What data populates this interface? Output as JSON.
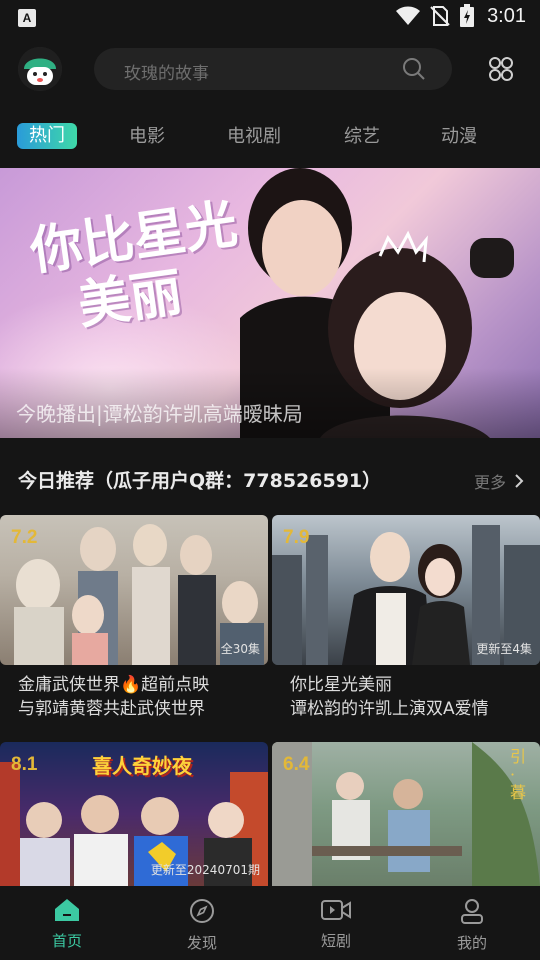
{
  "status_bar": {
    "time": "3:01",
    "left_icon": "A"
  },
  "header": {
    "search_placeholder": "玫瑰的故事"
  },
  "tabs": [
    {
      "label": "热门",
      "active": true
    },
    {
      "label": "电影"
    },
    {
      "label": "电视剧"
    },
    {
      "label": "综艺"
    },
    {
      "label": "动漫"
    }
  ],
  "banner": {
    "title_line1": "你比星光",
    "title_line2": "美丽",
    "caption": "今晚播出|谭松韵许凯高端暧昧局"
  },
  "section": {
    "title": "今日推荐（瓜子用户Q群：778526591）",
    "more_label": "更多"
  },
  "cards": [
    {
      "score": "7.2",
      "episodes": "全30集",
      "line1": "金庸武侠世界🔥超前点映",
      "line2": "与郭靖黄蓉共赴武侠世界"
    },
    {
      "score": "7.9",
      "episodes": "更新至4集",
      "line1": "你比星光美丽",
      "line2": "谭松韵的许凯上演双A爱情"
    },
    {
      "score": "8.1",
      "episodes": "更新至20240701期",
      "poster_text": "喜人奇妙夜"
    },
    {
      "score": "6.4",
      "episodes": "",
      "poster_text": "引·暮"
    }
  ],
  "bottom_nav": [
    {
      "label": "首页",
      "active": true
    },
    {
      "label": "发现"
    },
    {
      "label": "短剧"
    },
    {
      "label": "我的"
    }
  ],
  "colors": {
    "accent": "#3cc9a2",
    "background": "#151515",
    "score": "#e3b838"
  }
}
